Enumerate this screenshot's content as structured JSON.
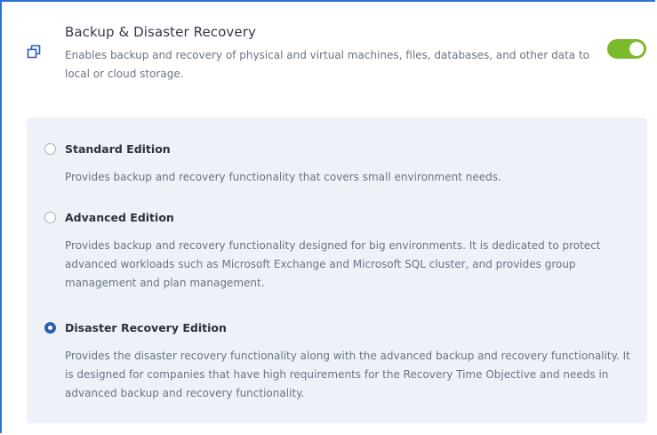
{
  "header": {
    "icon": "copy-icon",
    "title": "Backup & Disaster Recovery",
    "description": "Enables backup and recovery of physical and virtual machines, files, databases, and other data to local or cloud storage.",
    "enabled": true
  },
  "editions": [
    {
      "label": "Standard Edition",
      "description": "Provides backup and recovery functionality that covers small environment needs.",
      "selected": false
    },
    {
      "label": "Advanced Edition",
      "description": "Provides backup and recovery functionality designed for big environments. It is dedicated to protect advanced workloads such as Microsoft Exchange and Microsoft SQL cluster, and provides group management and plan management.",
      "selected": false
    },
    {
      "label": "Disaster Recovery Edition",
      "description": "Provides the disaster recovery functionality along with the advanced backup and recovery functionality. It is designed for companies that have high requirements for the Recovery Time Objective and needs in advanced backup and recovery functionality.",
      "selected": true
    }
  ],
  "colors": {
    "accent": "#2f5fb5",
    "toggle_on": "#7aba2c",
    "panel_bg": "#eef2f8"
  }
}
